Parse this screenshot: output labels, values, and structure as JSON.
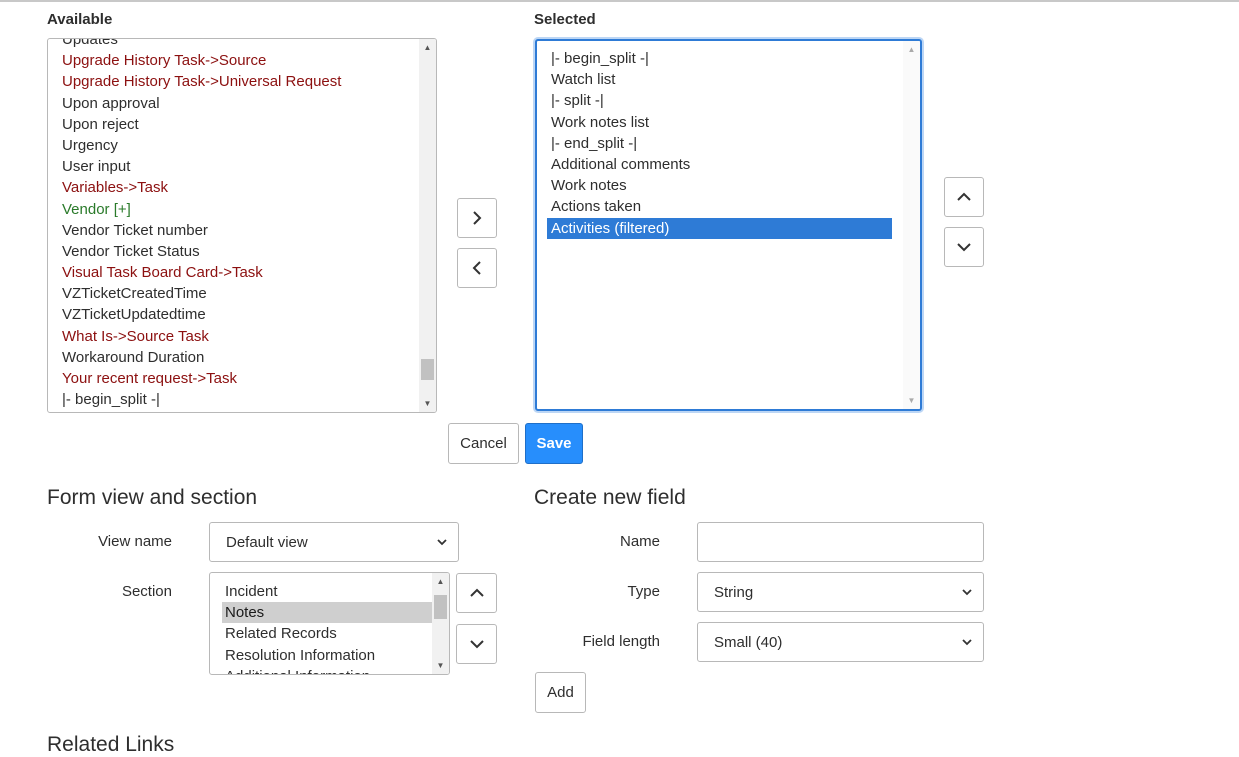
{
  "available": {
    "label": "Available",
    "items": [
      {
        "text": "Updates",
        "kind": "normal"
      },
      {
        "text": "Upgrade History Task->Source",
        "kind": "ref"
      },
      {
        "text": "Upgrade History Task->Universal Request",
        "kind": "ref"
      },
      {
        "text": "Upon approval",
        "kind": "normal"
      },
      {
        "text": "Upon reject",
        "kind": "normal"
      },
      {
        "text": "Urgency",
        "kind": "normal"
      },
      {
        "text": "User input",
        "kind": "normal"
      },
      {
        "text": "Variables->Task",
        "kind": "ref"
      },
      {
        "text": "Vendor [+]",
        "kind": "ext"
      },
      {
        "text": "Vendor Ticket number",
        "kind": "normal"
      },
      {
        "text": "Vendor Ticket Status",
        "kind": "normal"
      },
      {
        "text": "Visual Task Board Card->Task",
        "kind": "ref"
      },
      {
        "text": "VZTicketCreatedTime",
        "kind": "normal"
      },
      {
        "text": "VZTicketUpdatedtime",
        "kind": "normal"
      },
      {
        "text": "What Is->Source Task",
        "kind": "ref"
      },
      {
        "text": "Workaround Duration",
        "kind": "normal"
      },
      {
        "text": "Your recent request->Task",
        "kind": "ref"
      },
      {
        "text": "|- begin_split -|",
        "kind": "normal"
      }
    ]
  },
  "selected": {
    "label": "Selected",
    "items": [
      {
        "text": "|- begin_split -|",
        "selected": false
      },
      {
        "text": "Watch list",
        "selected": false
      },
      {
        "text": "|- split -|",
        "selected": false
      },
      {
        "text": "Work notes list",
        "selected": false
      },
      {
        "text": "|- end_split -|",
        "selected": false
      },
      {
        "text": "Additional comments",
        "selected": false
      },
      {
        "text": "Work notes",
        "selected": false
      },
      {
        "text": "Actions taken",
        "selected": false
      },
      {
        "text": "Activities (filtered)",
        "selected": true
      }
    ]
  },
  "actions": {
    "cancel": "Cancel",
    "save": "Save"
  },
  "form_view": {
    "title": "Form view and section",
    "view_name_label": "View name",
    "view_name_value": "Default view",
    "section_label": "Section",
    "sections": [
      {
        "text": "Incident",
        "selected": false
      },
      {
        "text": "Notes",
        "selected": true
      },
      {
        "text": "Related Records",
        "selected": false
      },
      {
        "text": "Resolution Information",
        "selected": false
      },
      {
        "text": "Additional Information",
        "selected": false
      }
    ]
  },
  "create_field": {
    "title": "Create new field",
    "name_label": "Name",
    "name_value": "",
    "type_label": "Type",
    "type_value": "String",
    "length_label": "Field length",
    "length_value": "Small (40)",
    "add_label": "Add"
  },
  "related_links": {
    "title": "Related Links"
  },
  "icons": {
    "move_right": "chevron-right-icon",
    "move_left": "chevron-left-icon",
    "move_up": "chevron-up-icon",
    "move_down": "chevron-down-icon"
  },
  "colors": {
    "accent": "#278efc",
    "reference": "#8c1010",
    "extension": "#2a7a2a",
    "selection": "#2e7bd6"
  }
}
